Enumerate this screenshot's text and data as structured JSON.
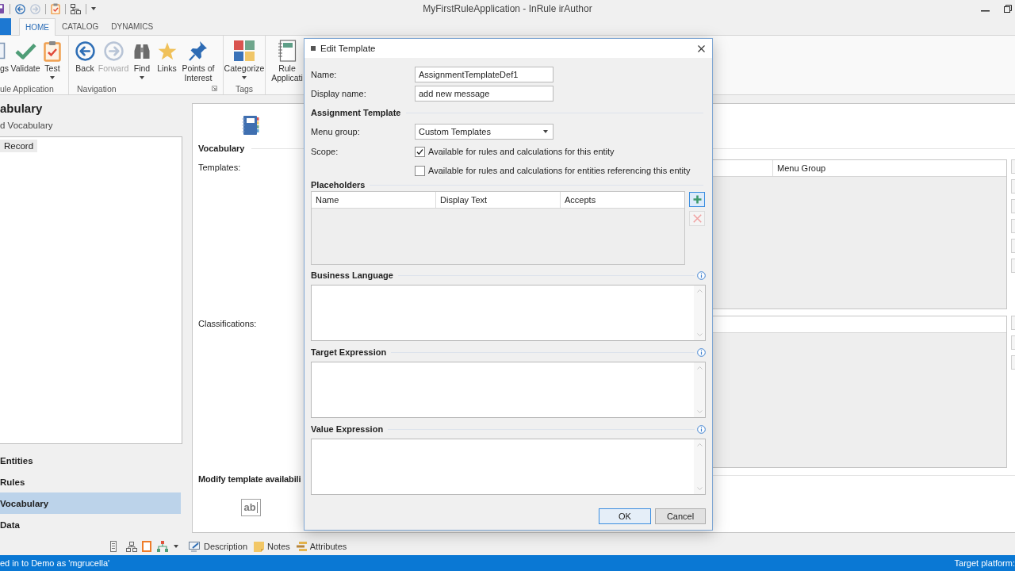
{
  "window": {
    "title": "MyFirstRuleApplication - InRule irAuthor"
  },
  "ribbon": {
    "tabs": [
      {
        "label": "HOME",
        "selected": true
      },
      {
        "label": "CATALOG",
        "selected": false
      },
      {
        "label": "DYNAMICS",
        "selected": false
      }
    ],
    "groups": [
      {
        "label": "ule Application",
        "launcher": false,
        "buttons": [
          {
            "label": "gs",
            "dropdown": false,
            "disabled": false
          },
          {
            "label": "Validate",
            "dropdown": false,
            "disabled": false
          },
          {
            "label": "Test",
            "dropdown": true,
            "disabled": false
          }
        ]
      },
      {
        "label": "Navigation",
        "launcher": true,
        "buttons": [
          {
            "label": "Back",
            "dropdown": false,
            "disabled": false
          },
          {
            "label": "Forward",
            "dropdown": false,
            "disabled": true
          },
          {
            "label": "Find",
            "dropdown": true,
            "disabled": false
          },
          {
            "label": "Links",
            "dropdown": false,
            "disabled": false
          },
          {
            "label": "Points of Interest",
            "dropdown": false,
            "disabled": false
          }
        ]
      },
      {
        "label": "Tags",
        "launcher": false,
        "buttons": [
          {
            "label": "Categorize",
            "dropdown": true,
            "disabled": false
          }
        ]
      },
      {
        "launcher": false,
        "buttons": [
          {
            "label": "Rule Applicati",
            "dropdown": false,
            "disabled": false
          }
        ]
      }
    ]
  },
  "explorer": {
    "title": "abulary",
    "subtitle": "d Vocabulary",
    "tree": [
      {
        "label": "Record",
        "selected": true
      }
    ],
    "nav": [
      {
        "label": "Entities",
        "selected": false
      },
      {
        "label": "Rules",
        "selected": false
      },
      {
        "label": "Vocabulary",
        "selected": true
      },
      {
        "label": "Data",
        "selected": false
      }
    ]
  },
  "content": {
    "section": "Vocabulary",
    "templates_label": "Templates:",
    "templates_columns": [
      "Menu Group"
    ],
    "classifications_label": "Classifications:",
    "availability_heading": "Modify template availabili",
    "field_icon_text": "ab"
  },
  "bottom_toolbar": {
    "tabs": [
      {
        "label": "Description"
      },
      {
        "label": "Notes"
      },
      {
        "label": "Attributes"
      }
    ]
  },
  "status_bar": {
    "left": "ed in to Demo as 'mgrucella'",
    "right": "Target platform:"
  },
  "dialog": {
    "title": "Edit Template",
    "fields": [
      {
        "label": "Name:",
        "value": "AssignmentTemplateDef1"
      },
      {
        "label": "Display name:",
        "value": "add new message"
      }
    ],
    "assignment": {
      "heading": "Assignment Template",
      "menu_group": {
        "label": "Menu group:",
        "value": "Custom Templates"
      },
      "scope": {
        "label": "Scope:",
        "options": [
          {
            "label": "Available for rules and calculations for this entity",
            "checked": true
          },
          {
            "label": "Available for rules and calculations for entities referencing this entity",
            "checked": false
          }
        ]
      }
    },
    "placeholders": {
      "heading": "Placeholders",
      "columns": [
        "Name",
        "Display Text",
        "Accepts"
      ],
      "tools": [
        {
          "kind": "add",
          "hovered": true,
          "disabled": false
        },
        {
          "kind": "delete",
          "hovered": false,
          "disabled": true
        }
      ]
    },
    "expressions": [
      {
        "heading": "Business Language"
      },
      {
        "heading": "Target Expression"
      },
      {
        "heading": "Value Expression"
      }
    ],
    "buttons": [
      {
        "label": "OK",
        "focused": true
      },
      {
        "label": "Cancel",
        "focused": false
      }
    ]
  }
}
